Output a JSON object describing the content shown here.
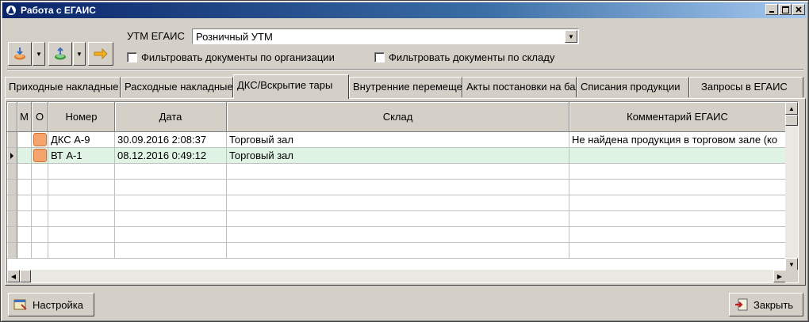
{
  "window": {
    "title": "Работа с ЕГАИС"
  },
  "toolbar": {
    "utm_label": "УТМ ЕГАИС",
    "utm_value": "Розничный УТМ",
    "filter_org_label": "Фильтровать документы по организации",
    "filter_warehouse_label": "Фильтровать документы по складу"
  },
  "tabs": [
    {
      "label": "Приходные накладные"
    },
    {
      "label": "Расходные накладные"
    },
    {
      "label": "ДКС/Вскрытие тары"
    },
    {
      "label": "Внутренние перемещения"
    },
    {
      "label": "Акты постановки на баланс"
    },
    {
      "label": "Списания продукции"
    },
    {
      "label": "Запросы в ЕГАИС"
    }
  ],
  "active_tab": 2,
  "table": {
    "columns": [
      "М",
      "О",
      "Номер",
      "Дата",
      "Склад",
      "Комментарий ЕГАИС"
    ],
    "rows": [
      {
        "number": "ДКС А-9",
        "date": "30.09.2016 2:08:37",
        "warehouse": "Торговый зал",
        "comment": "Не найдена продукция в торговом зале (ко"
      },
      {
        "number": "ВТ А-1",
        "date": "08.12.2016 0:49:12",
        "warehouse": "Торговый зал",
        "comment": ""
      }
    ],
    "selected_row": 1,
    "status_color": "#f4a46c"
  },
  "footer": {
    "settings_label": "Настройка",
    "close_label": "Закрыть"
  }
}
